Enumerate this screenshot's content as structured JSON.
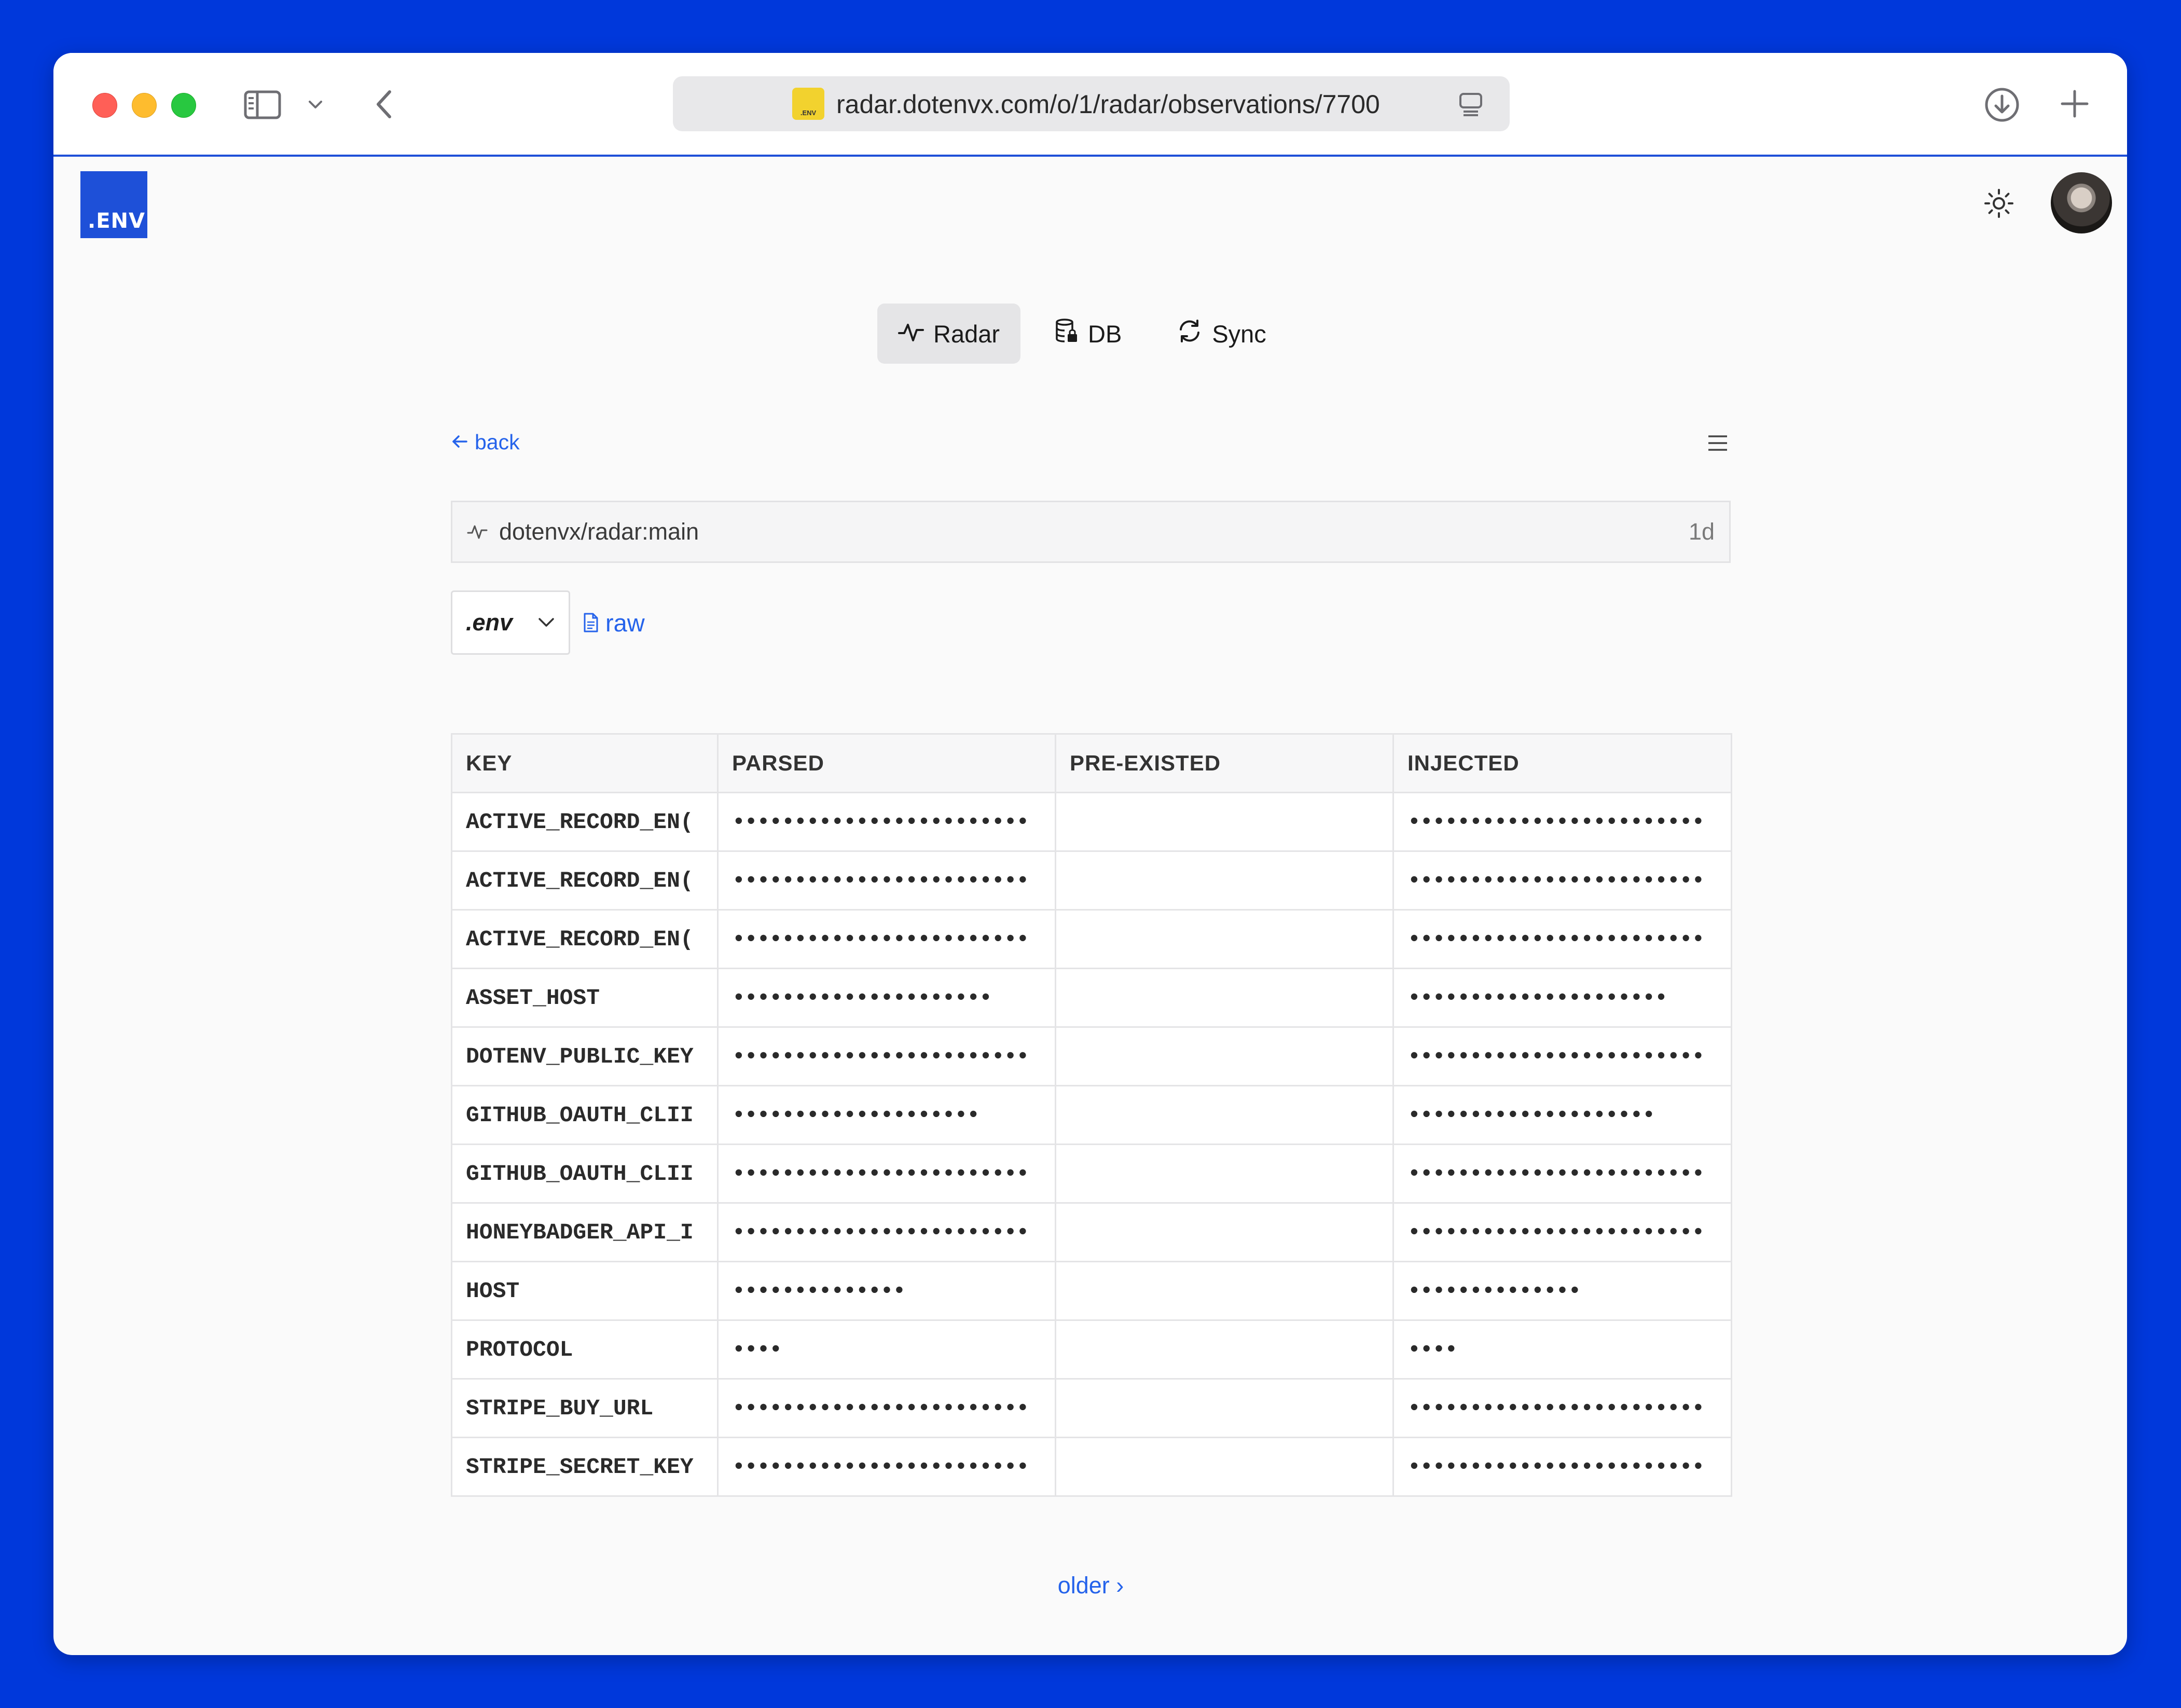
{
  "browser": {
    "url": "radar.dotenvx.com/o/1/radar/observations/7700",
    "favicon_text": ".ENV"
  },
  "app": {
    "logo_text": ".ENV",
    "nav": [
      {
        "label": "Radar",
        "icon": "activity-icon",
        "active": true
      },
      {
        "label": "DB",
        "icon": "database-lock-icon",
        "active": false
      },
      {
        "label": "Sync",
        "icon": "sync-icon",
        "active": false
      }
    ]
  },
  "observation": {
    "back_label": "back",
    "ref": "dotenvx/radar:main",
    "age": "1d",
    "file_selected": ".env",
    "raw_label": "raw",
    "older_label": "older ›"
  },
  "table": {
    "columns": [
      "KEY",
      "PARSED",
      "PRE-EXISTED",
      "INJECTED"
    ],
    "rows": [
      {
        "key": "ACTIVE_RECORD_EN(",
        "parsed": "••••••••••••••••••••••••",
        "preexisted": "",
        "injected": "••••••••••••••••••••••••"
      },
      {
        "key": "ACTIVE_RECORD_EN(",
        "parsed": "••••••••••••••••••••••••",
        "preexisted": "",
        "injected": "••••••••••••••••••••••••"
      },
      {
        "key": "ACTIVE_RECORD_EN(",
        "parsed": "••••••••••••••••••••••••",
        "preexisted": "",
        "injected": "••••••••••••••••••••••••"
      },
      {
        "key": "ASSET_HOST",
        "parsed": "•••••••••••••••••••••",
        "preexisted": "",
        "injected": "•••••••••••••••••••••"
      },
      {
        "key": "DOTENV_PUBLIC_KEY",
        "parsed": "••••••••••••••••••••••••",
        "preexisted": "",
        "injected": "••••••••••••••••••••••••"
      },
      {
        "key": "GITHUB_OAUTH_CLII",
        "parsed": "••••••••••••••••••••",
        "preexisted": "",
        "injected": "••••••••••••••••••••"
      },
      {
        "key": "GITHUB_OAUTH_CLII",
        "parsed": "••••••••••••••••••••••••",
        "preexisted": "",
        "injected": "••••••••••••••••••••••••"
      },
      {
        "key": "HONEYBADGER_API_I",
        "parsed": "••••••••••••••••••••••••",
        "preexisted": "",
        "injected": "••••••••••••••••••••••••"
      },
      {
        "key": "HOST",
        "parsed": "••••••••••••••",
        "preexisted": "",
        "injected": "••••••••••••••"
      },
      {
        "key": "PROTOCOL",
        "parsed": "••••",
        "preexisted": "",
        "injected": "••••"
      },
      {
        "key": "STRIPE_BUY_URL",
        "parsed": "••••••••••••••••••••••••",
        "preexisted": "",
        "injected": "••••••••••••••••••••••••"
      },
      {
        "key": "STRIPE_SECRET_KEY",
        "parsed": "••••••••••••••••••••••••",
        "preexisted": "",
        "injected": "••••••••••••••••••••••••"
      }
    ]
  }
}
